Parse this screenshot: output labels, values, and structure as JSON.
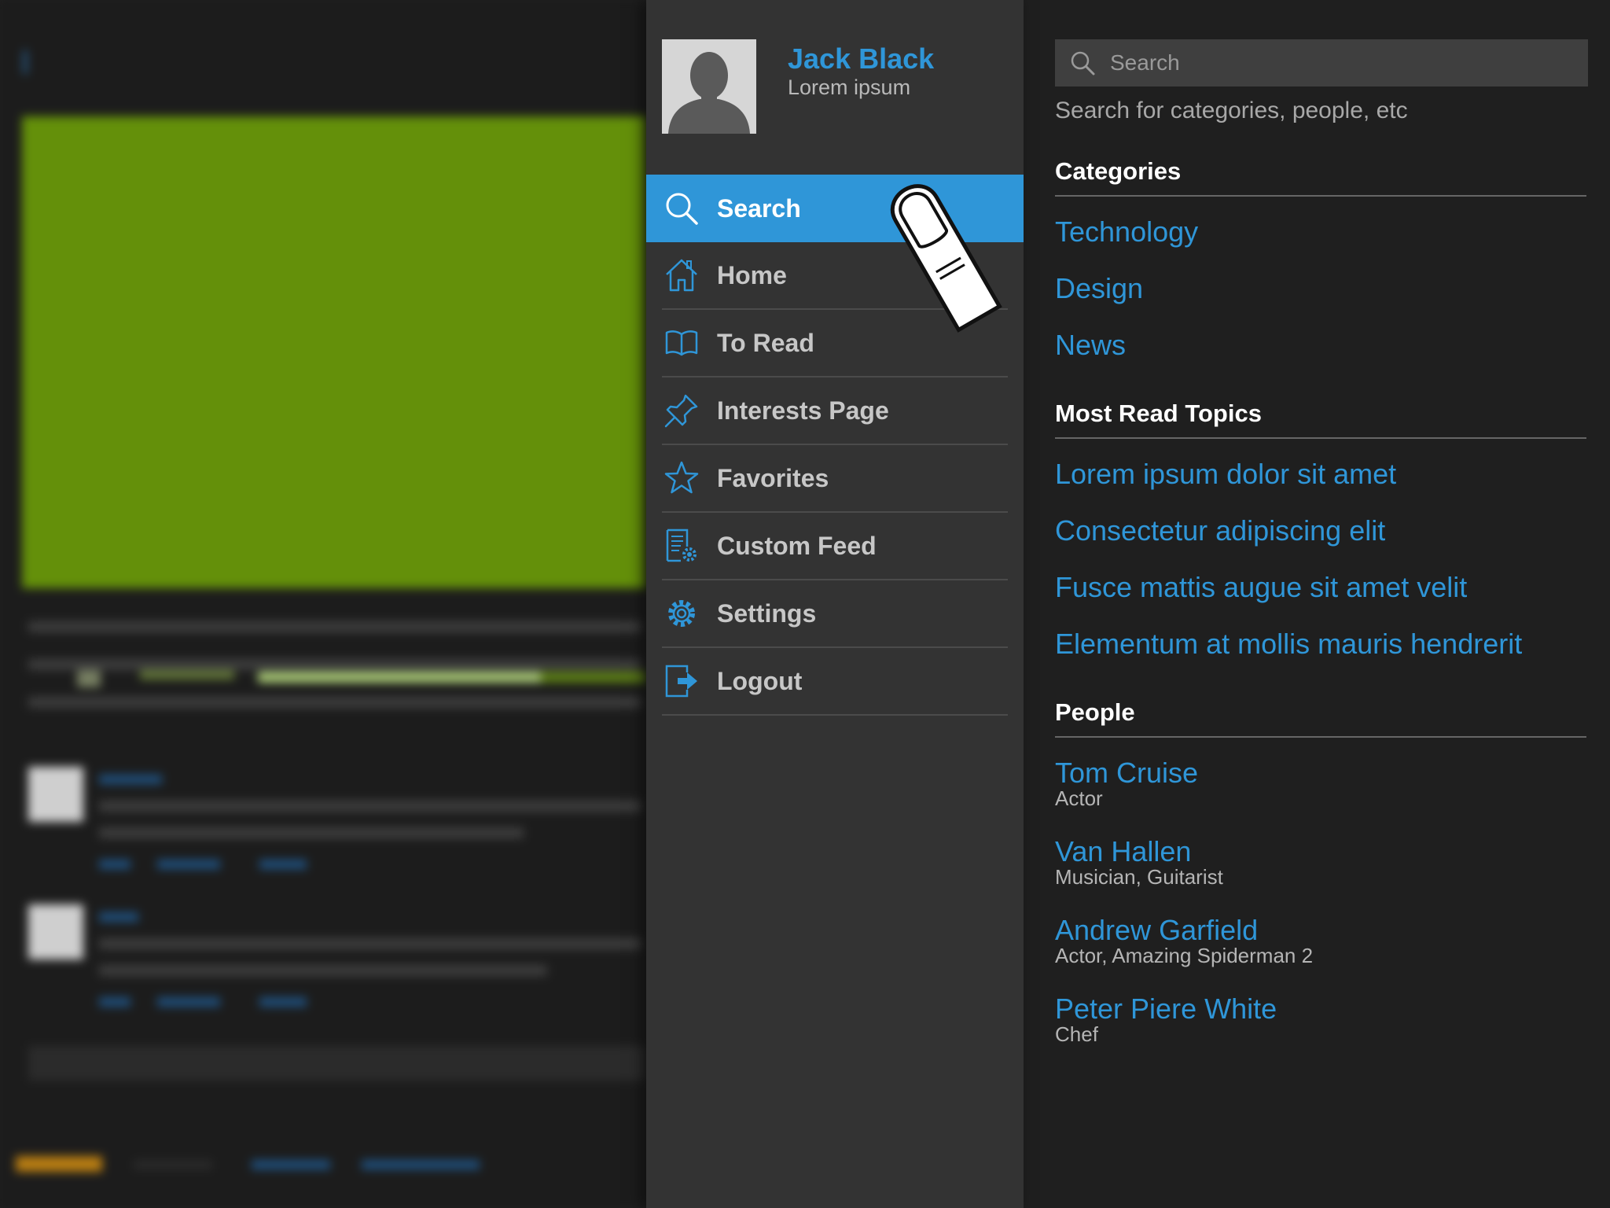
{
  "colors": {
    "accent": "#2f96d8",
    "drawer_bg": "#333333",
    "panel_bg": "#1f1f1f",
    "background_video": "#64900a"
  },
  "profile": {
    "name": "Jack Black",
    "subtitle": "Lorem ipsum",
    "avatar_icon": "user-silhouette-icon"
  },
  "menu": {
    "items": [
      {
        "label": "Search",
        "icon": "search-icon",
        "active": true
      },
      {
        "label": "Home",
        "icon": "home-icon"
      },
      {
        "label": "To Read",
        "icon": "book-icon"
      },
      {
        "label": "Interests Page",
        "icon": "pin-icon"
      },
      {
        "label": "Favorites",
        "icon": "star-icon"
      },
      {
        "label": "Custom Feed",
        "icon": "document-gear-icon"
      },
      {
        "label": "Settings",
        "icon": "gear-icon"
      },
      {
        "label": "Logout",
        "icon": "logout-icon"
      }
    ]
  },
  "search": {
    "placeholder": "Search",
    "hint": "Search for categories, people, etc"
  },
  "categories": {
    "title": "Categories",
    "items": [
      "Technology",
      "Design",
      "News"
    ]
  },
  "topics": {
    "title": "Most Read Topics",
    "items": [
      "Lorem ipsum dolor sit amet",
      "Consectetur adipiscing elit",
      "Fusce mattis augue sit amet velit",
      "Elementum at mollis mauris hendrerit"
    ]
  },
  "people": {
    "title": "People",
    "items": [
      {
        "name": "Tom Cruise",
        "role": "Actor"
      },
      {
        "name": "Van Hallen",
        "role": "Musician, Guitarist"
      },
      {
        "name": "Andrew Garfield",
        "role": "Actor, Amazing Spiderman 2"
      },
      {
        "name": "Peter Piere White",
        "role": "Chef"
      }
    ]
  }
}
